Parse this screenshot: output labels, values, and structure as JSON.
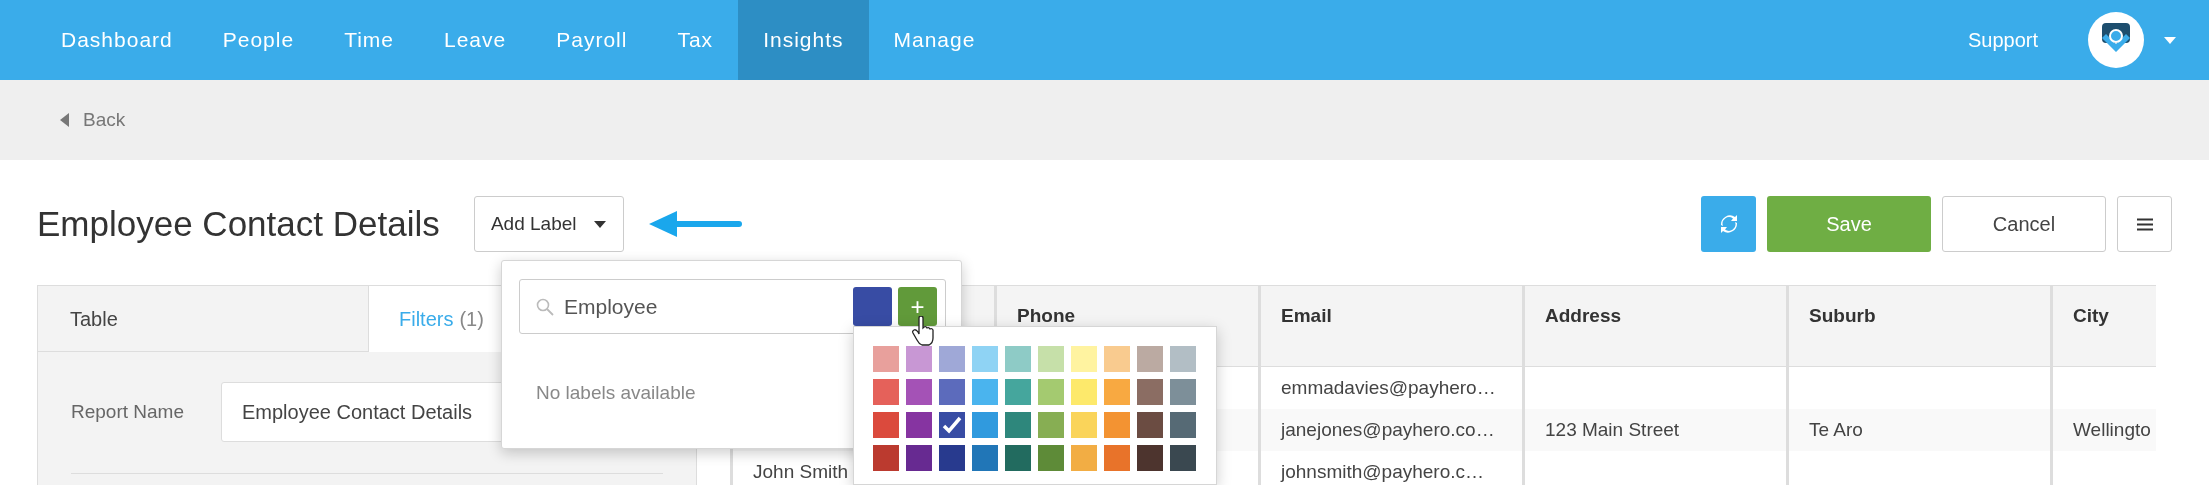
{
  "nav": {
    "items": [
      {
        "label": "Dashboard",
        "selected": false
      },
      {
        "label": "People",
        "selected": false
      },
      {
        "label": "Time",
        "selected": false
      },
      {
        "label": "Leave",
        "selected": false
      },
      {
        "label": "Payroll",
        "selected": false
      },
      {
        "label": "Tax",
        "selected": false
      },
      {
        "label": "Insights",
        "selected": true
      },
      {
        "label": "Manage",
        "selected": false
      }
    ],
    "support": "Support"
  },
  "back": "Back",
  "title": "Employee Contact Details",
  "add_label_button": "Add Label",
  "actions": {
    "save": "Save",
    "cancel": "Cancel"
  },
  "label_popup": {
    "search_value": "Employee",
    "add_button": "+",
    "empty_text": "No labels available"
  },
  "color_picker": [
    [
      {
        "color": "#e8a09c",
        "selected": false
      },
      {
        "color": "#c897d4",
        "selected": false
      },
      {
        "color": "#9fa8d7",
        "selected": false
      },
      {
        "color": "#8fd3f4",
        "selected": false
      },
      {
        "color": "#8ecbc6",
        "selected": false
      },
      {
        "color": "#c6e0a9",
        "selected": false
      },
      {
        "color": "#fff3a0",
        "selected": false
      },
      {
        "color": "#f9cb8f",
        "selected": false
      },
      {
        "color": "#bbaaa2",
        "selected": false
      },
      {
        "color": "#b2bec5",
        "selected": false
      }
    ],
    [
      {
        "color": "#e5615a",
        "selected": false
      },
      {
        "color": "#a452b6",
        "selected": false
      },
      {
        "color": "#5c6bbc",
        "selected": false
      },
      {
        "color": "#4ab4ee",
        "selected": false
      },
      {
        "color": "#45a69d",
        "selected": false
      },
      {
        "color": "#a4ca70",
        "selected": false
      },
      {
        "color": "#fde96b",
        "selected": false
      },
      {
        "color": "#f8a941",
        "selected": false
      },
      {
        "color": "#8b6d63",
        "selected": false
      },
      {
        "color": "#7d8f99",
        "selected": false
      }
    ],
    [
      {
        "color": "#db4a3d",
        "selected": false
      },
      {
        "color": "#8634a1",
        "selected": false
      },
      {
        "color": "#384ca4",
        "selected": true
      },
      {
        "color": "#309ade",
        "selected": false
      },
      {
        "color": "#2e877c",
        "selected": false
      },
      {
        "color": "#87ae53",
        "selected": false
      },
      {
        "color": "#fad45a",
        "selected": false
      },
      {
        "color": "#f39332",
        "selected": false
      },
      {
        "color": "#6b4c42",
        "selected": false
      },
      {
        "color": "#566a75",
        "selected": false
      }
    ],
    [
      {
        "color": "#bb3a2f",
        "selected": false
      },
      {
        "color": "#672a91",
        "selected": false
      },
      {
        "color": "#283a8e",
        "selected": false
      },
      {
        "color": "#2176b7",
        "selected": false
      },
      {
        "color": "#226b5f",
        "selected": false
      },
      {
        "color": "#5e8b38",
        "selected": false
      },
      {
        "color": "#f2ad44",
        "selected": false
      },
      {
        "color": "#e8732a",
        "selected": false
      },
      {
        "color": "#4d342e",
        "selected": false
      },
      {
        "color": "#3a4850",
        "selected": false
      }
    ]
  ],
  "left_panel": {
    "tabs": [
      {
        "label": "Table",
        "selected": false
      },
      {
        "label": "Filters",
        "count": "(1)",
        "selected": true
      }
    ],
    "report_name_label": "Report Name",
    "report_name_value": "Employee Contact Details"
  },
  "table": {
    "columns": [
      null,
      "Phone",
      "Email",
      "Address",
      "Suburb",
      "City"
    ],
    "rows": [
      {
        "cells": [
          null,
          null,
          "emmadavies@payhero…",
          null,
          null,
          null
        ]
      },
      {
        "cells": [
          null,
          null,
          "janejones@payhero.co…",
          "123 Main Street",
          "Te Aro",
          "Wellingto"
        ]
      },
      {
        "cells": [
          "John Smith",
          null,
          "johnsmith@payhero.c…",
          null,
          null,
          null
        ]
      }
    ]
  }
}
